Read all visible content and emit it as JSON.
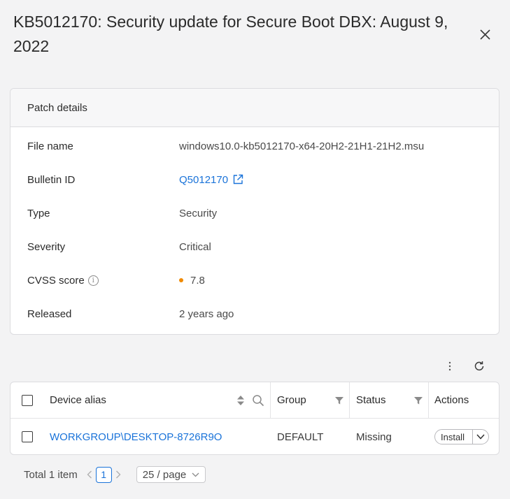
{
  "dialog": {
    "title": "KB5012170: Security update for Secure Boot DBX: August 9, 2022"
  },
  "patch_details": {
    "header": "Patch details",
    "rows": [
      {
        "label": "File name",
        "value": "windows10.0-kb5012170-x64-20H2-21H1-21H2.msu"
      },
      {
        "label": "Bulletin ID",
        "value": "Q5012170"
      },
      {
        "label": "Type",
        "value": "Security"
      },
      {
        "label": "Severity",
        "value": "Critical"
      },
      {
        "label": "CVSS score",
        "value": "7.8"
      },
      {
        "label": "Released",
        "value": "2 years ago"
      }
    ]
  },
  "table": {
    "columns": {
      "device_alias": "Device alias",
      "group": "Group",
      "status": "Status",
      "actions": "Actions"
    },
    "rows": [
      {
        "device_alias": "WORKGROUP\\DESKTOP-8726R9O",
        "group": "DEFAULT",
        "status": "Missing",
        "action_label": "Install"
      }
    ]
  },
  "pagination": {
    "total": "Total 1 item",
    "current_page": "1",
    "page_size": "25 / page"
  },
  "colors": {
    "link": "#1a73d9",
    "cvss_dot": "#f08a00"
  }
}
